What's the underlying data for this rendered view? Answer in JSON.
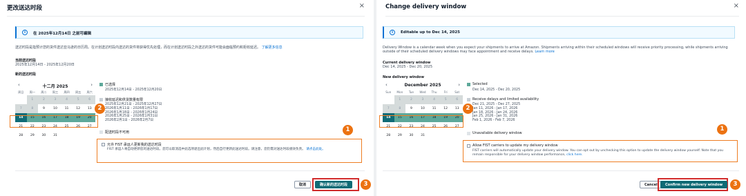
{
  "colors": {
    "selected": "#5ea89a",
    "first_selected": "#0f6b76",
    "unavailable": "#d5dbdb",
    "annotation": "#ec7211",
    "highlight_box": "#d12b2b",
    "link": "#0972d3",
    "primary_button": "#0f6b76"
  },
  "zh": {
    "title": "更改送达时段",
    "close_icon": "×",
    "info": "在 2025年12月14日 之前可编辑",
    "description": "送达时段是指预计您的货件送达亚马逊的日历周。在计划送达时段内送达的货件将获得优先处理，而在计划送达时段之外送达的货件可能会面临预约和拒收延迟。",
    "learn_more": "了解更多信息",
    "current_label": "当前送达时段",
    "current_value": "2025年12月14日 - 2025年12月20日",
    "new_label": "新的送达时段",
    "month": "十二月 2025",
    "prev": "‹",
    "next": "›",
    "dows": [
      "周日",
      "周一",
      "周二",
      "周三",
      "周四",
      "周五",
      "周六"
    ],
    "legend_selected": "已选择",
    "legend_selected_range": "2025年12月14日 - 2025年12月20日",
    "legend_delays": "接收延迟和供货数量有限",
    "legend_delays_ranges": [
      "2025年12月21日 - 2025年12月27日",
      "2026年1月11日 - 2026年1月17日",
      "2026年1月18日 - 2026年1月24日",
      "2026年1月25日 - 2026年1月31日",
      "2026年2月1日 - 2026年2月7日"
    ],
    "legend_unavailable": "配送时段不可用",
    "checkbox_title": "允许 FIST 承运人更新我的送达时段",
    "checkbox_desc": "FIST 承运人将自动更新您的送达时段。您可以取消选中此选项退出此计划，然后自行更新此送达时段。请注意，您仍需对送达时段绩效负责。",
    "checkbox_link": "请点击此处。",
    "cancel": "取消",
    "confirm": "确认新的送达时段"
  },
  "en": {
    "title": "Change delivery window",
    "close_icon": "×",
    "info": "Editable up to Dec 14, 2025",
    "description": "Delivery Window is a calendar week when you expect your shipments to arrive at Amazon. Shipments arriving within their scheduled windows will receive priority processing, while shipments arriving outside of their scheduled delivery windows may face appointment and receive delays.",
    "learn_more": "Learn more",
    "current_label": "Current delivery window",
    "current_value": "Dec 14, 2025 - Dec 20, 2025",
    "new_label": "New delivery window",
    "month": "December 2025",
    "prev": "‹",
    "next": "›",
    "dows": [
      "Sun",
      "Mon",
      "Tue",
      "Wed",
      "Thu",
      "Fri",
      "Sat"
    ],
    "legend_selected": "Selected",
    "legend_selected_range": "Dec 14, 2025 - Dec 20, 2025",
    "legend_delays": "Receive delays and limited availability",
    "legend_delays_ranges": [
      "Dec 21, 2025 - Dec 27, 2025",
      "Jan 11, 2026 - Jan 17, 2026",
      "Jan 18, 2026 - Jan 24, 2026",
      "Jan 25, 2026 - Jan 31, 2026",
      "Feb 1, 2026 - Feb 7, 2026"
    ],
    "legend_unavailable": "Unavailable delivery window",
    "checkbox_title": "Allow FIST carriers to update my delivery window",
    "checkbox_desc": "FIST carriers will automatically update your delivery window. You can opt out by unchecking this option to update the delivery window yourself. Note that you remain responsible for your delivery window performance,",
    "checkbox_link": "click here.",
    "cancel": "Cancel",
    "confirm": "Confirm new delivery window"
  },
  "calendar_weeks": [
    [
      {
        "d": "",
        "s": "emp"
      },
      {
        "d": "1",
        "s": "un"
      },
      {
        "d": "2",
        "s": "un"
      },
      {
        "d": "3",
        "s": "un"
      },
      {
        "d": "4",
        "s": "un"
      },
      {
        "d": "5",
        "s": "un"
      },
      {
        "d": "6",
        "s": "un"
      }
    ],
    [
      {
        "d": "7",
        "s": "un"
      },
      {
        "d": "8",
        "s": "un"
      },
      {
        "d": "9",
        "s": ""
      },
      {
        "d": "10",
        "s": ""
      },
      {
        "d": "11",
        "s": ""
      },
      {
        "d": "12",
        "s": ""
      },
      {
        "d": "13",
        "s": ""
      }
    ],
    [
      {
        "d": "14",
        "s": "first"
      },
      {
        "d": "15",
        "s": "sel"
      },
      {
        "d": "16",
        "s": "sel"
      },
      {
        "d": "17",
        "s": "sel"
      },
      {
        "d": "18",
        "s": "sel"
      },
      {
        "d": "19",
        "s": "sel"
      },
      {
        "d": "20",
        "s": "sel"
      }
    ],
    [
      {
        "d": "21",
        "s": ""
      },
      {
        "d": "22",
        "s": ""
      },
      {
        "d": "23",
        "s": ""
      },
      {
        "d": "24",
        "s": ""
      },
      {
        "d": "25",
        "s": ""
      },
      {
        "d": "26",
        "s": ""
      },
      {
        "d": "27",
        "s": ""
      }
    ],
    [
      {
        "d": "28",
        "s": ""
      },
      {
        "d": "29",
        "s": ""
      },
      {
        "d": "30",
        "s": ""
      },
      {
        "d": "31",
        "s": ""
      },
      {
        "d": "",
        "s": "emp"
      },
      {
        "d": "",
        "s": "emp"
      },
      {
        "d": "",
        "s": "emp"
      }
    ]
  ],
  "badges": {
    "one": "1",
    "two": "2",
    "three": "3"
  }
}
